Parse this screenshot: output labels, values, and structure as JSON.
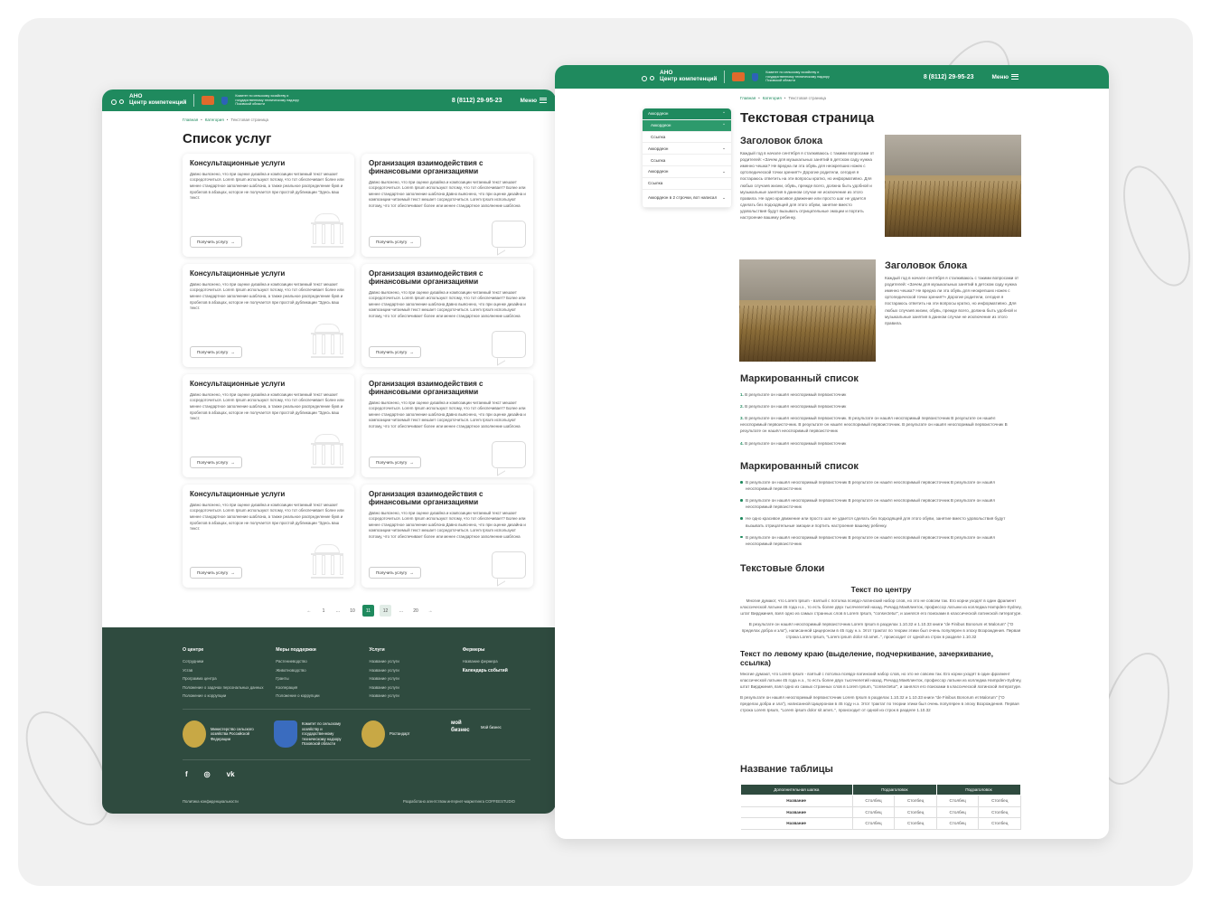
{
  "header": {
    "org_short": "АНО",
    "org_name": "Центр компетенций",
    "committee": "Комитет по сельскому хозяйству и государственному техническому надзору Псковской области",
    "phone": "8 (8112) 29-95-23",
    "menu": "Меню"
  },
  "page1": {
    "breadcrumb": [
      "Главная",
      "Категория",
      "Текстовая страница"
    ],
    "title": "Список услуг",
    "cards": [
      {
        "title": "Консультационные услуги",
        "text": "Давно выяснено, что при оценке дизайна и композиции читаемый текст мешает сосредоточиться. Lorem Ipsum используют потому, что тот обеспечивает более или менее стандартное заполнение шаблона, а также реальное распределение букв и пробелов в абзацах, которое не получается при простой дубликации \"Здесь ваш текст.",
        "button": "Получить услугу",
        "icon": "bank-icon"
      },
      {
        "title": "Организация взаимодействия с финансовыми организациями",
        "text": "Давно выяснено, что при оценке дизайна и композиции читаемый текст мешает сосредоточиться. Lorem Ipsum используют потому, что тот обеспечивает? Более или менее стандартное заполнение шаблона Давно выяснено, что при оценке дизайна и композиции читаемый текст мешает сосредоточиться. Lorem Ipsum используют потому, что тот обеспечивает более или менее стандартное заполнение шаблона",
        "button": "Получить услугу",
        "icon": "chat-icon"
      },
      {
        "title": "Консультационные услуги",
        "text": "Давно выяснено, что при оценке дизайна и композиции читаемый текст мешает сосредоточиться. Lorem Ipsum используют потому, что тот обеспечивает более или менее стандартное заполнение шаблона, а также реальное распределение букв и пробелов в абзацах, которое не получается при простой дубликации \"Здесь ваш текст.",
        "button": "Получить услугу",
        "icon": "bank-icon"
      },
      {
        "title": "Организация взаимодействия с финансовыми организациями",
        "text": "Давно выяснено, что при оценке дизайна и композиции читаемый текст мешает сосредоточиться. Lorem Ipsum используют потому, что тот обеспечивает? Более или менее стандартное заполнение шаблона Давно выяснено, что при оценке дизайна и композиции читаемый текст мешает сосредоточиться. Lorem Ipsum используют потому, что тот обеспечивает более или менее стандартное заполнение шаблона",
        "button": "Получить услугу",
        "icon": "chat-icon"
      },
      {
        "title": "Консультационные услуги",
        "text": "Давно выяснено, что при оценке дизайна и композиции читаемый текст мешает сосредоточиться. Lorem Ipsum используют потому, что тот обеспечивает более или менее стандартное заполнение шаблона, а также реальное распределение букв и пробелов в абзацах, которое не получается при простой дубликации \"Здесь ваш текст.",
        "button": "Получить услугу",
        "icon": "bank-icon"
      },
      {
        "title": "Организация взаимодействия с финансовыми организациями",
        "text": "Давно выяснено, что при оценке дизайна и композиции читаемый текст мешает сосредоточиться. Lorem Ipsum используют потому, что тот обеспечивает? Более или менее стандартное заполнение шаблона Давно выяснено, что при оценке дизайна и композиции читаемый текст мешает сосредоточиться. Lorem Ipsum используют потому, что тот обеспечивает более или менее стандартное заполнение шаблона",
        "button": "Получить услугу",
        "icon": "chat-icon"
      },
      {
        "title": "Консультационные услуги",
        "text": "Давно выяснено, что при оценке дизайна и композиции читаемый текст мешает сосредоточиться. Lorem Ipsum используют потому, что тот обеспечивает более или менее стандартное заполнение шаблона, а также реальное распределение букв и пробелов в абзацах, которое не получается при простой дубликации \"Здесь ваш текст.",
        "button": "Получить услугу",
        "icon": "bank-icon"
      },
      {
        "title": "Организация взаимодействия с финансовыми организациями",
        "text": "Давно выяснено, что при оценке дизайна и композиции читаемый текст мешает сосредоточиться. Lorem Ipsum используют потому, что тот обеспечивает? Более или менее стандартное заполнение шаблона Давно выяснено, что при оценке дизайна и композиции читаемый текст мешает сосредоточиться. Lorem Ipsum используют потому, что тот обеспечивает более или менее стандартное заполнение шаблона",
        "button": "Получить услугу",
        "icon": "chat-icon"
      }
    ],
    "pagination": [
      "←",
      "1",
      "...",
      "10",
      "11",
      "12",
      "...",
      "20",
      "→"
    ],
    "pagination_active": "11",
    "footer": {
      "cols": [
        {
          "title": "О центре",
          "items": [
            "Сотрудники",
            "Устав",
            "Программа центра",
            "Положение о задачах персональных данных",
            "Положение о коррупции"
          ]
        },
        {
          "title": "Меры поддержки",
          "items": [
            "Растениеводство",
            "Животноводство",
            "Гранты",
            "Кооперация",
            "Положение о коррупции"
          ]
        },
        {
          "title": "Услуги",
          "items": [
            "Название услуги",
            "Название услуги",
            "Название услуги",
            "Название услуги",
            "Название услуги"
          ]
        },
        {
          "title": "Фермеры",
          "items": [
            "Название фермера",
            "Календарь событий"
          ]
        }
      ],
      "partners": [
        "Министерство сельского хозяйства Российской Федерации",
        "Комитет по сельскому хозяйству и государственному техническому надзору Псковской области",
        "Ростандарт",
        "Мой бизнес"
      ],
      "partner_logo_text": "мой бизнес",
      "social": [
        "f",
        "◎",
        "vk"
      ],
      "privacy": "Политика конфиденциальности",
      "developer": "Разработано агентством интернет-маркетинга COFFEESTUDIO"
    }
  },
  "page2": {
    "breadcrumb": [
      "Главная",
      "Категория",
      "Текстовая страница"
    ],
    "title": "Текстовая страница",
    "accordion": [
      "Аккордеон",
      "Аккордеон",
      "Ссылка",
      "Аккордеон",
      "Ссылка",
      "Аккордеон",
      "Ссылка",
      "Аккордеон в 2 строчки, вот написал"
    ],
    "block1": {
      "title": "Заголовок блока",
      "text": "Каждый год в начале сентября я сталкиваюсь с такими вопросами от родителей: «Зачем для музыкальных занятий в детском саду нужна именно чешка? Не вредна ли эта обувь для неокрепших ножек с ортопедической точки зрения?» Дорогие родители, сегодня я постараюсь ответить на эти вопросы кратко, но информативно. Для любых случаев жизни, обувь, прежде всего, должна быть удобной и музыкальные занятия в данном случае не исключение из этого правила. Не одно красивое движение или просто шаг не удается сделать без подходящей для этого обуви, занятие вместо удовольствия будут вызывать отрицательные эмоции и портить настроение вашему ребенку."
    },
    "block2": {
      "title": "Заголовок блока",
      "text": "Каждый год в начале сентября я сталкиваюсь с такими вопросами от родителей: «Зачем для музыкальных занятий в детском саду нужна именно чешка? Не вредна ли эта обувь для неокрепших ножек с ортопедической точки зрения?» Дорогие родители, сегодня я постараюсь ответить на эти вопросы кратко, но информативно. Для любых случаев жизни, обувь, прежде всего, должна быть удобной и музыкальные занятия в данном случае не исключение из этого правила."
    },
    "ol_title": "Маркированный список",
    "ol": [
      "В результате он нашёл неоспоримый первоисточник",
      "В результате он нашёл неоспоримый первоисточник",
      "В результате он нашёл неоспоримый первоисточник. В результате он нашёл неоспоримый первоисточник В результате он нашёл неоспоримый первоисточник. В результате он нашёл неоспоримый первоисточник. В результате он нашёл неоспоримый первоисточник В результате он нашёл неоспоримый первоисточник",
      "В результате он нашёл неоспоримый первоисточник"
    ],
    "ul_title": "Маркированный список",
    "ul": [
      "В результате он нашёл неоспоримый первоисточник В результате он нашёл неоспоримый первоисточник В результате он нашёл неоспоримый первоисточник",
      "В результате он нашёл неоспоримый первоисточник В результате он нашёл неоспоримый первоисточник В результате он нашёл неоспоримый первоисточник",
      "Не одно красивое движение или просто шаг не удается сделать без подходящей для этого обуви, занятие вместо удовольствия будут вызывать отрицательные эмоции и портить настроение вашему ребенку.",
      "В результате он нашёл неоспоримый первоисточник В результате он нашёл неоспоримый первоисточник В результате он нашёл неоспоримый первоисточник"
    ],
    "textblocks_title": "Текстовые блоки",
    "center_title": "Текст по центру",
    "center_p1": "Многие думают, что Lorem Ipsum - взятый с потолка псевдо-латинский набор слов, но это не совсем так. Его корни уходят в один фрагмент классической латыни 45 года н.э., то есть более двух тысячелетий назад. Ричард МакКлинток, профессор латыни из колледжа Hampden-Sydney, штат Вирджиния, взял одно из самых странных слов в Lorem Ipsum, \"consectetur\", и занялся его поисками в классической латинской литературе.",
    "center_p2": "В результате он нашёл неоспоримый первоисточник Lorem Ipsum в разделах 1.10.32 и 1.10.33 книги \"de Finibus Bonorum et Malorum\" (\"О пределах добра и зла\"), написанной Цицероном в 45 году н.э. Этот трактат по теории этики был очень популярен в эпоху Возрождения. Первая строка Lorem Ipsum, \"Lorem ipsum dolor sit amet..\", происходит от одной из строк в разделе 1.10.32",
    "left_title": "Текст по левому краю (выделение, подчеркивание, зачеркивание, ссылка)",
    "left_p1": "Многие думают, что Lorem Ipsum - взятый с потолка псевдо-латинский набор слов, но это не совсем так. Его корни уходят в один фрагмент классической латыни 45 года н.э., то есть более двух тысячелетий назад. Ричард МакКлинток, профессор латыни из колледжа Hampden-Sydney, штат Вирджиния, взял одно из самых странных слов в Lorem Ipsum, \"consectetur\", и занялся его поисками в классической латинской литературе.",
    "left_p2": "В результате он нашёл неоспоримый первоисточник Lorem Ipsum в разделах 1.10.32 и 1.10.33 книги \"de Finibus Bonorum et Malorum\" (\"О пределах добра и зла\"), написанной Цицероном в 45 году н.э. Этот трактат по теории этики был очень популярен в эпоху Возрождения. Первая строка Lorem Ipsum, \"Lorem ipsum dolor sit amet..\", происходит от одной из строк в разделе 1.10.32",
    "table_title": "Название таблицы",
    "table_head": [
      "Дополнительная шапка",
      "Подзаголовок",
      "Подзаголовок"
    ],
    "table_rows": [
      [
        "Название",
        "Столбец",
        "Столбец",
        "Столбец",
        "Столбец"
      ],
      [
        "Название",
        "Столбец",
        "Столбец",
        "Столбец",
        "Столбец"
      ],
      [
        "Название",
        "Столбец",
        "Столбец",
        "Столбец",
        "Столбец"
      ]
    ]
  },
  "colors": {
    "brand": "#1f8a5e",
    "footer": "#2f4b3f",
    "canvas": "#f1f1f1"
  }
}
